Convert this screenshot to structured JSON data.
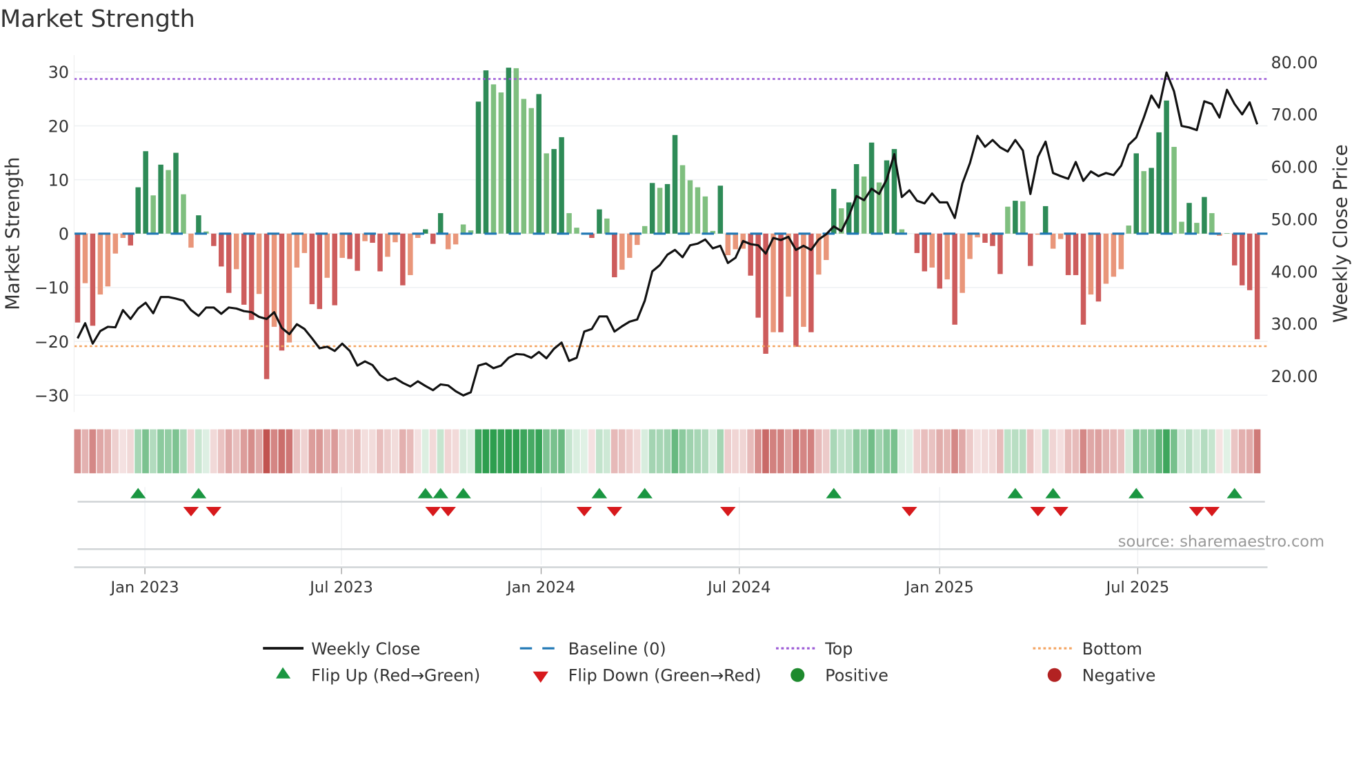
{
  "title": "Market Strength",
  "source": "source: sharemaestro.com",
  "colors": {
    "pos_strong": "#2e8b57",
    "pos_weak": "#7fbf7f",
    "neg_strong": "#cd5c5c",
    "neg_weak": "#e9967a",
    "baseline": "#1f77b4",
    "top": "#9b59d6",
    "bottom": "#f4a460",
    "line": "#111111",
    "flip_up": "#1a9641",
    "flip_down": "#d7191c",
    "positive": "#1e8a2e",
    "negative": "#b22222"
  },
  "legend": {
    "weekly_close": "Weekly Close",
    "baseline": "Baseline (0)",
    "top": "Top",
    "bottom": "Bottom",
    "flip_up": "Flip Up (Red→Green)",
    "flip_down": "Flip Down (Green→Red)",
    "positive": "Positive",
    "negative": "Negative"
  },
  "chart_data": {
    "type": "bar",
    "title": "Market Strength",
    "ylabel": "Market Strength",
    "y2label": "Weekly Close Price",
    "ylim": [
      -33,
      33
    ],
    "y2lim": [
      14.5,
      83
    ],
    "yticks": [
      30,
      20,
      10,
      0,
      -10,
      -20,
      -30
    ],
    "ytick_labels": [
      "30",
      "20",
      "10",
      "0",
      "−10",
      "−20",
      "−30"
    ],
    "y2ticks": [
      80,
      70,
      60,
      50,
      40,
      30,
      20
    ],
    "y2tick_labels": [
      "80.00",
      "70.00",
      "60.00",
      "50.00",
      "40.00",
      "30.00",
      "20.00"
    ],
    "xticks": [
      {
        "label": "Jan 2023",
        "week": 8.9
      },
      {
        "label": "Jul 2023",
        "week": 34.9
      },
      {
        "label": "Jan 2024",
        "week": 61.3
      },
      {
        "label": "Jul 2024",
        "week": 87.5
      },
      {
        "label": "Jan 2025",
        "week": 114
      },
      {
        "label": "Jul 2025",
        "week": 140.2
      }
    ],
    "top_level": 28.7,
    "bottom_level": -20.9,
    "strength": [
      -16.5,
      -9.2,
      -17.1,
      -11.3,
      -9.8,
      -3.7,
      -0.8,
      -2.2,
      8.6,
      15.3,
      7.1,
      12.8,
      11.8,
      15.0,
      7.3,
      -2.6,
      3.4,
      0.4,
      -2.3,
      -6.1,
      -11,
      -6.6,
      -13.2,
      -16,
      -11.2,
      -27,
      -17.3,
      -21.7,
      -20.2,
      -6.3,
      -3.6,
      -13.1,
      -14,
      -8.2,
      -13.3,
      -4.5,
      -4.7,
      -6.9,
      -1.4,
      -1.7,
      -7,
      -4.3,
      -1.6,
      -9.6,
      -7.7,
      -0.8,
      0.8,
      -1.9,
      3.8,
      -2.9,
      -2,
      1.7,
      0.6,
      24.5,
      30.3,
      27.7,
      26.2,
      30.8,
      30.7,
      25,
      23.3,
      25.9,
      14.9,
      15.7,
      17.9,
      3.8,
      1.1,
      0,
      -0.8,
      4.5,
      2.8,
      -8.1,
      -6.7,
      -4.5,
      -2.1,
      1.4,
      9.4,
      8.5,
      9.2,
      18.3,
      12.7,
      9.9,
      8.6,
      6.9,
      0.5,
      8.9,
      -4.0,
      -2.9,
      -2.8,
      -7.8,
      -15.6,
      -22.3,
      -18.3,
      -18.3,
      -11.7,
      -21,
      -17.3,
      -18.3,
      -7.6,
      -4.9,
      8.3,
      4.7,
      5.8,
      12.9,
      10.6,
      16.9,
      9.5,
      13.6,
      15.7,
      0.8,
      0,
      -3.6,
      -7,
      -6.3,
      -10.2,
      -8.5,
      -16.9,
      -11,
      -4.7,
      -0.7,
      -1.7,
      -2.3,
      -7.5,
      5.0,
      6.1,
      6.0,
      -6.0,
      -0.2,
      5.1,
      -2.8,
      -1.0,
      -7.7,
      -7.7,
      -16.9,
      -11.3,
      -12.6,
      -9.3,
      -8,
      -6.6,
      1.5,
      14.9,
      11.6,
      12.2,
      18.8,
      24.7,
      16.1,
      2.2,
      5.7,
      2.0,
      6.8,
      3.8,
      -0.4,
      0.1,
      -5.9,
      -9.6,
      -10.5,
      -19.6
    ],
    "weekly_close": [
      27.2,
      30.1,
      26.2,
      28.6,
      29.4,
      29.3,
      32.6,
      30.9,
      32.9,
      34.0,
      32.0,
      35.1,
      35.1,
      34.8,
      34.4,
      32.6,
      31.5,
      33.1,
      33.1,
      31.9,
      33.1,
      32.9,
      32.4,
      32.2,
      31.3,
      30.9,
      32.2,
      29.2,
      28.0,
      29.9,
      29.0,
      27.2,
      25.3,
      25.6,
      24.8,
      26.2,
      24.8,
      22.0,
      22.8,
      22.1,
      20.2,
      19.2,
      19.6,
      18.7,
      18.0,
      19.0,
      18.1,
      17.3,
      18.4,
      18.2,
      17.1,
      16.3,
      16.9,
      22.0,
      22.4,
      21.5,
      22.0,
      23.5,
      24.2,
      24.1,
      23.5,
      24.6,
      23.4,
      25.2,
      26.4,
      22.9,
      23.5,
      28.5,
      29.0,
      31.4,
      31.4,
      28.5,
      29.5,
      30.4,
      30.8,
      34.4,
      40.0,
      41.2,
      43.2,
      44.1,
      42.7,
      45.0,
      45.3,
      46.1,
      44.4,
      44.9,
      41.6,
      42.6,
      45.8,
      45.2,
      45.0,
      43.4,
      46.4,
      46.0,
      46.6,
      44.1,
      44.9,
      44.1,
      46.1,
      47.1,
      48.6,
      47.7,
      50.6,
      54.4,
      53.6,
      55.8,
      54.8,
      57.6,
      62.4,
      54.2,
      55.5,
      53.5,
      53.0,
      54.9,
      53.2,
      53.2,
      50.2,
      56.8,
      60.7,
      65.9,
      63.8,
      65.1,
      63.7,
      62.9,
      65.1,
      63.1,
      54.8,
      61.9,
      64.8,
      58.8,
      58.2,
      57.7,
      60.9,
      57.3,
      59.1,
      58.2,
      58.8,
      58.4,
      60.2,
      64.2,
      65.6,
      69.4,
      73.6,
      71.3,
      78.0,
      74.4,
      67.8,
      67.5,
      67.0,
      72.5,
      72.0,
      69.4,
      74.7,
      72.0,
      70.0,
      72.3,
      68.1
    ],
    "flip_up_weeks": [
      8,
      16,
      46,
      48,
      51,
      69,
      75,
      100,
      124,
      129,
      140,
      153
    ],
    "flip_down_weeks": [
      15,
      18,
      47,
      49,
      67,
      71,
      86,
      110,
      127,
      130,
      148,
      150
    ],
    "legend_position": "bottom"
  }
}
